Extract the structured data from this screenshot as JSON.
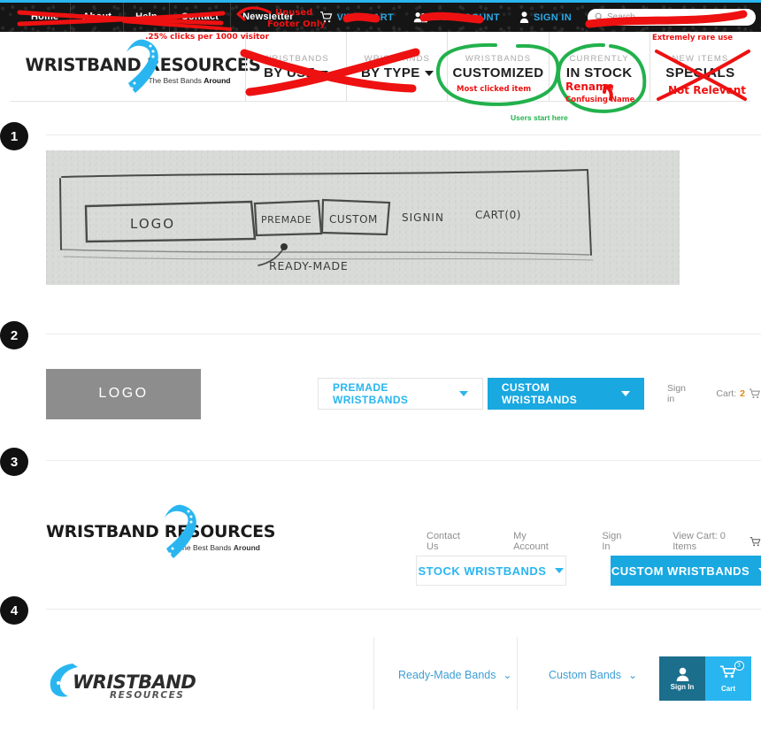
{
  "screenshot": {
    "topbar": {
      "nav_items": [
        {
          "label": "Home"
        },
        {
          "label": "About"
        },
        {
          "label": "Help"
        },
        {
          "label": "Contact"
        },
        {
          "label": "Newsletter"
        }
      ],
      "view_cart": "VIEW CART",
      "my_account": "MY ACCOUNT",
      "sign_in": "SIGN IN",
      "search_placeholder": "Search",
      "accent_color": "#29b6f0",
      "background_color": "#151515"
    },
    "mainnav": {
      "brand_line1": "WRISTBAND RESOURCES",
      "brand_tagline_normal": "The Best Bands ",
      "brand_tagline_bold": "Around",
      "items": [
        {
          "small": "WRISTBANDS",
          "big": "BY USE",
          "has_caret": true
        },
        {
          "small": "WRISTBANDS",
          "big": "BY TYPE",
          "has_caret": true
        },
        {
          "small": "WRISTBANDS",
          "big": "CUSTOMIZED",
          "has_caret": false
        },
        {
          "small": "CURRENTLY",
          "big": "IN STOCK",
          "has_caret": false
        },
        {
          "small": "NEW ITEMS",
          "big": "SPECIALS",
          "has_caret": false
        }
      ]
    },
    "annotations": {
      "unused_footer_line1": "Unused",
      "unused_footer_line2": "Footer Only",
      "clicks_stat": ".25% clicks per 1000 visitor",
      "most_clicked": "Most clicked item",
      "users_start_here": "Users start here",
      "rename": "Rename",
      "confusing_name": "Confusing Name",
      "extremely_rare": "Extremely rare use",
      "not_relevant": "Not Relevant",
      "marker_red": "#ee1111",
      "marker_green": "#22b14c"
    }
  },
  "sections": [
    {
      "number": "1",
      "sketch": {
        "logo": "LOGO",
        "premade": "PREMADE",
        "custom": "CUSTOM",
        "signin": "SIGNIN",
        "cart": "CART(0)",
        "callout": "READY-MADE"
      }
    },
    {
      "number": "2",
      "concept": {
        "logo_label": "LOGO",
        "premade_button": "PREMADE WRISTBANDS",
        "custom_button": "CUSTOM WRISTBANDS",
        "sign_in": "Sign in",
        "cart_label": "Cart:",
        "cart_count": "2"
      }
    },
    {
      "number": "3",
      "concept": {
        "brand_line1": "WRISTBAND RESOURCES",
        "brand_tagline_normal": "The Best Bands ",
        "brand_tagline_bold": "Around",
        "links": [
          {
            "label": "Contact Us"
          },
          {
            "label": "My Account"
          },
          {
            "label": "Sign In"
          },
          {
            "label": "View Cart: 0 Items"
          }
        ],
        "stock_button": "STOCK WRISTBANDS",
        "custom_button": "CUSTOM WRISTBANDS"
      }
    },
    {
      "number": "4",
      "concept": {
        "brand_line1": "WRISTBAND",
        "brand_line2": "RESOURCES",
        "ready_made": "Ready-Made Bands",
        "custom_bands": "Custom Bands",
        "sign_in": "Sign In",
        "cart": "Cart",
        "cart_badge": "3",
        "signin_color": "#1b6e8c",
        "cart_color": "#29b6f0"
      }
    }
  ]
}
